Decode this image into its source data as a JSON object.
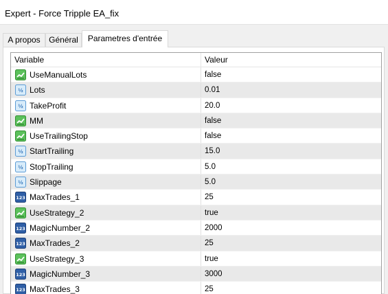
{
  "window": {
    "title": "Expert - Force Tripple EA_fix"
  },
  "tabs": [
    {
      "label": "A propos",
      "active": false
    },
    {
      "label": "Général",
      "active": false
    },
    {
      "label": "Parametres d'entrée",
      "active": true
    }
  ],
  "table": {
    "headers": {
      "variable": "Variable",
      "value": "Valeur"
    },
    "rows": [
      {
        "icon": "boolean-icon",
        "name": "UseManualLots",
        "value": "false"
      },
      {
        "icon": "double-icon",
        "name": "Lots",
        "value": "0.01"
      },
      {
        "icon": "double-icon",
        "name": "TakeProfit",
        "value": "20.0"
      },
      {
        "icon": "boolean-icon",
        "name": "MM",
        "value": "false"
      },
      {
        "icon": "boolean-icon",
        "name": "UseTrailingStop",
        "value": "false"
      },
      {
        "icon": "double-icon",
        "name": "StartTrailing",
        "value": "15.0"
      },
      {
        "icon": "double-icon",
        "name": "StopTrailing",
        "value": "5.0"
      },
      {
        "icon": "double-icon",
        "name": "Slippage",
        "value": "5.0"
      },
      {
        "icon": "integer-icon",
        "name": "MaxTrades_1",
        "value": "25"
      },
      {
        "icon": "boolean-icon",
        "name": "UseStrategy_2",
        "value": "true"
      },
      {
        "icon": "integer-icon",
        "name": "MagicNumber_2",
        "value": "2000"
      },
      {
        "icon": "integer-icon",
        "name": "MaxTrades_2",
        "value": "25"
      },
      {
        "icon": "boolean-icon",
        "name": "UseStrategy_3",
        "value": "true"
      },
      {
        "icon": "integer-icon",
        "name": "MagicNumber_3",
        "value": "3000"
      },
      {
        "icon": "integer-icon",
        "name": "MaxTrades_3",
        "value": "25"
      }
    ]
  }
}
